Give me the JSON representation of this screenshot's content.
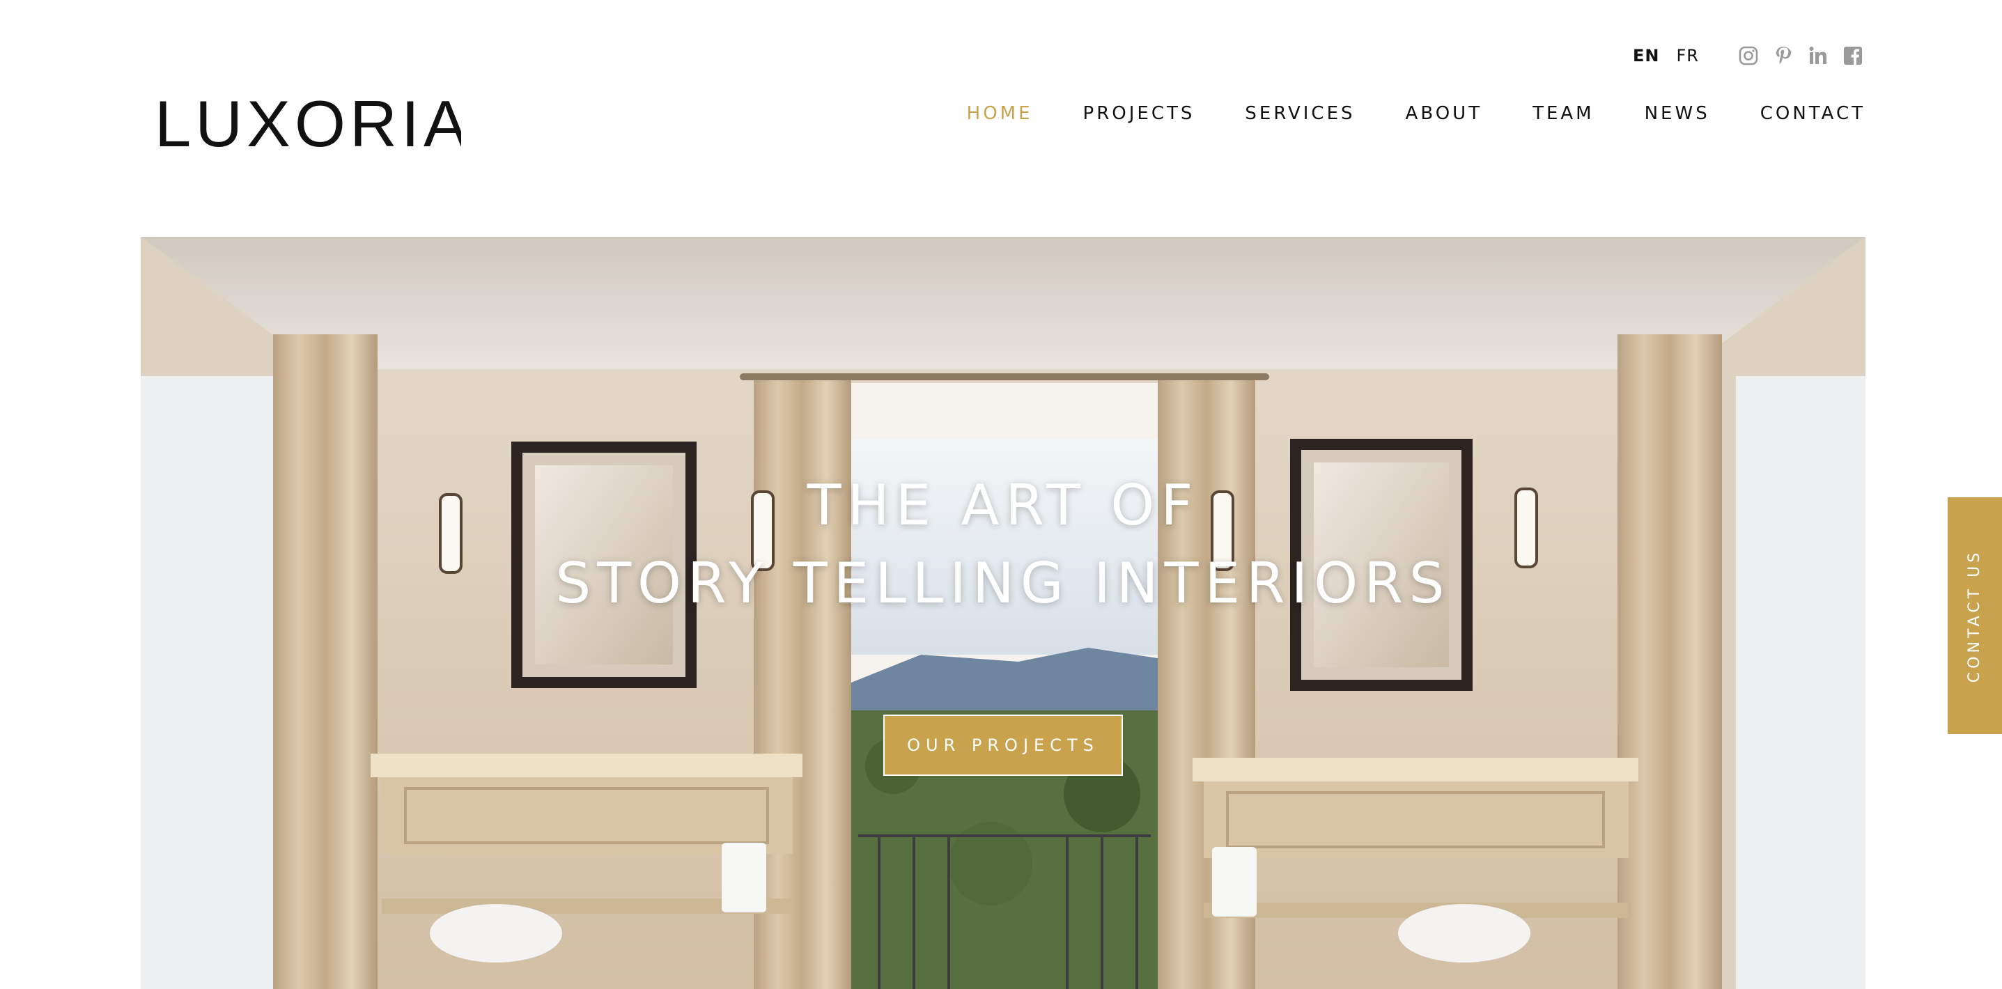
{
  "brand": {
    "name": "LUXORIA"
  },
  "header": {
    "languages": [
      {
        "label": "EN",
        "active": true
      },
      {
        "label": "FR",
        "active": false
      }
    ],
    "social_icons": [
      "instagram-icon",
      "pinterest-icon",
      "linkedin-icon",
      "facebook-icon"
    ],
    "nav": [
      {
        "label": "HOME",
        "active": true
      },
      {
        "label": "PROJECTS",
        "active": false
      },
      {
        "label": "SERVICES",
        "active": false
      },
      {
        "label": "ABOUT",
        "active": false
      },
      {
        "label": "TEAM",
        "active": false
      },
      {
        "label": "NEWS",
        "active": false
      },
      {
        "label": "CONTACT",
        "active": false
      }
    ]
  },
  "hero": {
    "title_line1": "THE ART OF",
    "title_line2": "STORY TELLING INTERIORS",
    "cta_label": "OUR PROJECTS"
  },
  "side_tab": {
    "label": "CONTACT US"
  },
  "colors": {
    "accent": "#c9a24e",
    "text": "#111111",
    "icon_gray": "#9a9a9a",
    "background": "#ffffff"
  }
}
